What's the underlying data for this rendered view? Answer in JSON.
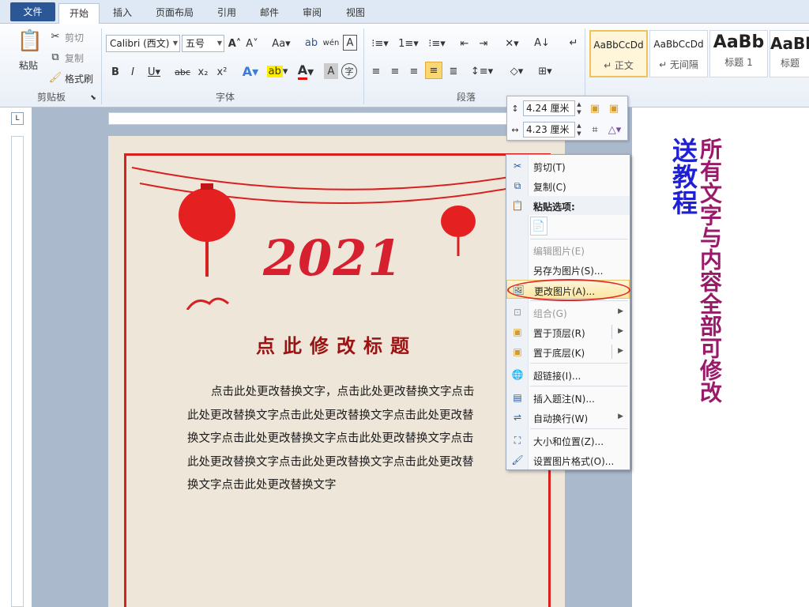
{
  "tabs": {
    "file": "文件",
    "home": "开始",
    "insert": "插入",
    "layout": "页面布局",
    "refs": "引用",
    "mail": "邮件",
    "review": "审阅",
    "view": "视图"
  },
  "clipboard": {
    "paste": "粘贴",
    "cut": "剪切",
    "copy": "复制",
    "format_painter": "格式刷",
    "group": "剪贴板"
  },
  "font": {
    "name": "Calibri (西文)",
    "size": "五号",
    "group": "字体"
  },
  "paragraph": {
    "group": "段落"
  },
  "styles": [
    {
      "sample": "AaBbCcDd",
      "name": "↵ 正文"
    },
    {
      "sample": "AaBbCcDd",
      "name": "↵ 无间隔"
    },
    {
      "sample": "AaBb",
      "name": "标题 1"
    },
    {
      "sample": "AaBl",
      "name": "标题"
    }
  ],
  "mini_toolbar": {
    "height": "4.24 厘米",
    "width": "4.23 厘米"
  },
  "document": {
    "year": "2021",
    "title": "点此修改标题",
    "body": "点击此处更改替换文字，点击此处更改替换文字点击此处更改替换文字点击此处更改替换文字点击此处更改替换文字点击此处更改替换文字点击此处更改替换文字点击此处更改替换文字点击此处更改替换文字点击此处更改替换文字点击此处更改替换文字"
  },
  "context_menu": {
    "cut": "剪切(T)",
    "copy": "复制(C)",
    "paste_options": "粘贴选项:",
    "edit_picture": "编辑图片(E)",
    "save_as_picture": "另存为图片(S)...",
    "change_picture": "更改图片(A)...",
    "group": "组合(G)",
    "bring_front": "置于顶层(R)",
    "send_back": "置于底层(K)",
    "hyperlink": "超链接(I)...",
    "insert_caption": "插入题注(N)...",
    "wrap_text": "自动换行(W)",
    "size_position": "大小和位置(Z)...",
    "format_picture": "设置图片格式(O)..."
  },
  "promo": {
    "tutorial": "送教程",
    "all_editable": "所有文字与内容全部可修改"
  }
}
